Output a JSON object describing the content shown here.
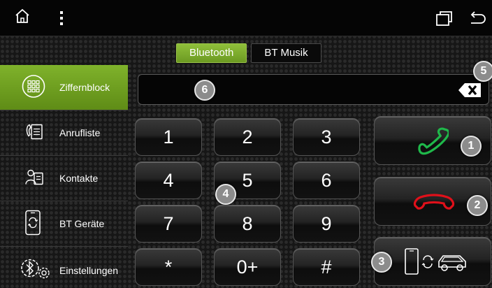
{
  "tabs": [
    {
      "label": "Bluetooth",
      "active": true
    },
    {
      "label": "BT Musik",
      "active": false
    }
  ],
  "sidebar": {
    "items": [
      {
        "label": "Ziffernblock",
        "icon": "keypad-icon",
        "active": true
      },
      {
        "label": "Anrufliste",
        "icon": "call-log-icon",
        "active": false
      },
      {
        "label": "Kontakte",
        "icon": "contacts-icon",
        "active": false
      },
      {
        "label": "BT Geräte",
        "icon": "phone-sync-icon",
        "active": false
      },
      {
        "label": "Einstellungen",
        "icon": "bluetooth-settings-icon",
        "active": false
      }
    ]
  },
  "display": {
    "value": ""
  },
  "keypad": {
    "keys": [
      "1",
      "2",
      "3",
      "4",
      "5",
      "6",
      "7",
      "8",
      "9",
      "*",
      "0+",
      "#"
    ]
  },
  "actions": {
    "call": {
      "icon": "call-accept-icon",
      "color": "#1fb84a"
    },
    "hangup": {
      "icon": "call-end-icon",
      "color": "#e0101a"
    },
    "connect": {
      "icon": "phone-car-connect-icon"
    }
  },
  "markers": [
    "1",
    "2",
    "3",
    "4",
    "5",
    "6"
  ],
  "colors": {
    "accent": "#7fb22b",
    "marker": "#8c8c8c"
  }
}
